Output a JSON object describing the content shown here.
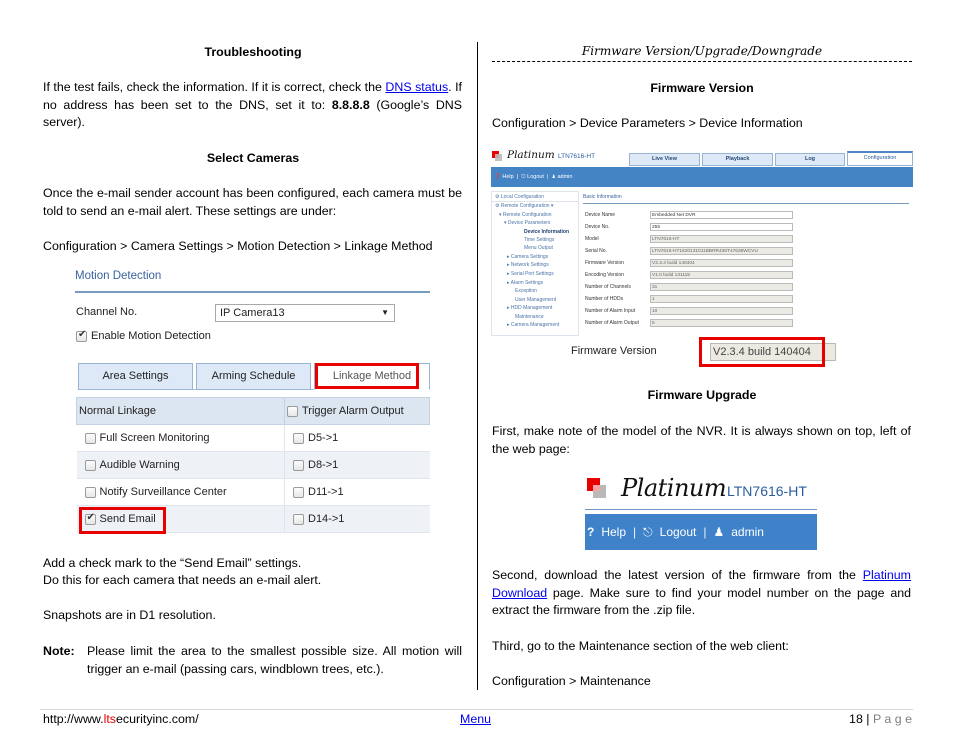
{
  "left_column": {
    "troubleshooting": {
      "heading": "Troubleshooting",
      "para_part1": "If the test fails, check the information.  If it is correct, check the ",
      "link": "DNS status",
      "para_part2": ".  If no address has been set to the DNS, set it to: ",
      "dns_value": "8.8.8.8",
      "para_part3": " (Google’s DNS server)."
    },
    "select_cameras": {
      "heading": "Select Cameras",
      "para": "Once the e-mail sender account has been configured, each camera must be told to send an e-mail alert.  These settings are under:",
      "path": "Configuration > Camera Settings > Motion Detection > Linkage Method"
    },
    "motion_detection_screenshot": {
      "title": "Motion Detection",
      "channel_label": "Channel No.",
      "channel_value": "IP Camera13",
      "enable_label": "Enable Motion Detection",
      "enable_checked": true,
      "tabs": [
        {
          "label": "Area Settings",
          "active": false
        },
        {
          "label": "Arming Schedule",
          "active": false
        },
        {
          "label": "Linkage Method",
          "active": true
        }
      ],
      "table_headers": [
        "Normal Linkage",
        "Trigger Alarm Output"
      ],
      "rows": [
        {
          "linkage": "Full Screen Monitoring",
          "checked": false,
          "output": "D5->1"
        },
        {
          "linkage": "Audible Warning",
          "checked": false,
          "output": "D8->1"
        },
        {
          "linkage": "Notify Surveillance Center",
          "checked": false,
          "output": "D11->1"
        },
        {
          "linkage": "Send Email",
          "checked": true,
          "output": "D14->1"
        }
      ]
    },
    "after": {
      "line1": "Add a check mark to the “Send Email” settings.",
      "line2": "Do this for each camera that needs an e-mail alert.",
      "snapshots": "Snapshots are in D1 resolution.",
      "note_label": "Note:",
      "note_text": "Please limit the area to the smallest possible size.  All motion will trigger an e-mail (passing cars, windblown trees, etc.)."
    }
  },
  "right_column": {
    "header": "Firmware Version/Upgrade/Downgrade",
    "firmware_version": {
      "heading": "Firmware Version",
      "path": "Configuration > Device Parameters > Device Information"
    },
    "config_screenshot": {
      "brand": "Platinum",
      "model": "LTN7616-HT",
      "top_tabs": [
        {
          "label": "Live View",
          "active": false
        },
        {
          "label": "Playback",
          "active": false
        },
        {
          "label": "Log",
          "active": false
        },
        {
          "label": "Configuration",
          "active": true
        }
      ],
      "bar_items": [
        "Help",
        "Logout",
        "admin"
      ],
      "sidebar": [
        "Local Configuration",
        "Remote Configuration",
        "Remote Configuration",
        "Device Parameters",
        "Device Information",
        "Time Settings",
        "Menu Output",
        "Camera Settings",
        "Network Settings",
        "Serial Port Settings",
        "Alarm Settings",
        "Exception",
        "User Management",
        "HDD Management",
        "Maintenance",
        "Camera Management"
      ],
      "section_title": "Basic Information",
      "fields": [
        {
          "label": "Device Name",
          "value": "Embedded Net DVR",
          "editable": true
        },
        {
          "label": "Device No.",
          "value": "255",
          "editable": true
        },
        {
          "label": "Model",
          "value": "LTN7616-HT",
          "editable": false
        },
        {
          "label": "Serial No.",
          "value": "LTN7616-HT1620131011BBRR436T47636WCVU",
          "editable": false
        },
        {
          "label": "Firmware Version",
          "value": "V2.3.4 build 140404",
          "editable": false
        },
        {
          "label": "Encoding Version",
          "value": "V1.0 build 131115",
          "editable": false
        },
        {
          "label": "Number of Channels",
          "value": "31",
          "editable": false
        },
        {
          "label": "Number of HDDs",
          "value": "1",
          "editable": false
        },
        {
          "label": "Number of Alarm Input",
          "value": "10",
          "editable": false
        },
        {
          "label": "Number of Alarm Output",
          "value": "5",
          "editable": false
        }
      ]
    },
    "firmware_zoom": {
      "label": "Firmware Version",
      "value": "V2.3.4 build 140404"
    },
    "firmware_upgrade": {
      "heading": "Firmware Upgrade",
      "first": "First, make note of the model of the NVR.  It is always shown on top, left of the web page:",
      "header_image": {
        "brand": "Platinum",
        "model": "LTN7616-HT",
        "help": "Help",
        "logout": "Logout",
        "user": "admin"
      },
      "second_part1": "Second, download the latest version of the firmware from the ",
      "second_link": "Platinum Download",
      "second_part2": " page.  Make sure to find your model number on the page and extract the firmware from the .zip file.",
      "third": "Third, go to the Maintenance section of the web client:",
      "path": "Configuration > Maintenance"
    }
  },
  "footer": {
    "url_prefix": "http://www.",
    "url_highlight": "lts",
    "url_suffix": "ecurityinc.com/",
    "menu_link": "Menu",
    "page_number": "18",
    "page_label": "P a g e"
  },
  "colors": {
    "link": "#0000ee",
    "highlight_red": "#e60000",
    "nav_blue": "#4584c4"
  }
}
